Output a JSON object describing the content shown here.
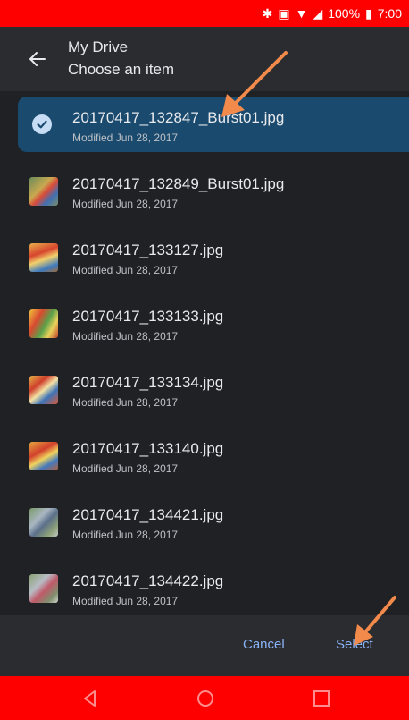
{
  "status_bar": {
    "icons": [
      "bluetooth-icon",
      "nfc-icon",
      "wifi-icon",
      "signal-icon"
    ],
    "battery": "100%",
    "time": "7:00"
  },
  "app_bar": {
    "title": "My Drive",
    "subtitle": "Choose an item",
    "back_icon": "arrow-back-icon"
  },
  "files": [
    {
      "name": "20170417_132847_Burst01.jpg",
      "modified": "Modified Jun 28, 2017",
      "selected": true
    },
    {
      "name": "20170417_132849_Burst01.jpg",
      "modified": "Modified Jun 28, 2017",
      "selected": false
    },
    {
      "name": "20170417_133127.jpg",
      "modified": "Modified Jun 28, 2017",
      "selected": false
    },
    {
      "name": "20170417_133133.jpg",
      "modified": "Modified Jun 28, 2017",
      "selected": false
    },
    {
      "name": "20170417_133134.jpg",
      "modified": "Modified Jun 28, 2017",
      "selected": false
    },
    {
      "name": "20170417_133140.jpg",
      "modified": "Modified Jun 28, 2017",
      "selected": false
    },
    {
      "name": "20170417_134421.jpg",
      "modified": "Modified Jun 28, 2017",
      "selected": false
    },
    {
      "name": "20170417_134422.jpg",
      "modified": "Modified Jun 28, 2017",
      "selected": false
    }
  ],
  "actions": {
    "cancel_label": "Cancel",
    "select_label": "Select"
  },
  "colors": {
    "status_bar": "#ff0000",
    "nav_bar": "#ff0000",
    "background": "#202124",
    "selected_row": "#1a4a6e",
    "accent": "#8ab4f8",
    "annotation_arrow": "#f28a4b"
  }
}
